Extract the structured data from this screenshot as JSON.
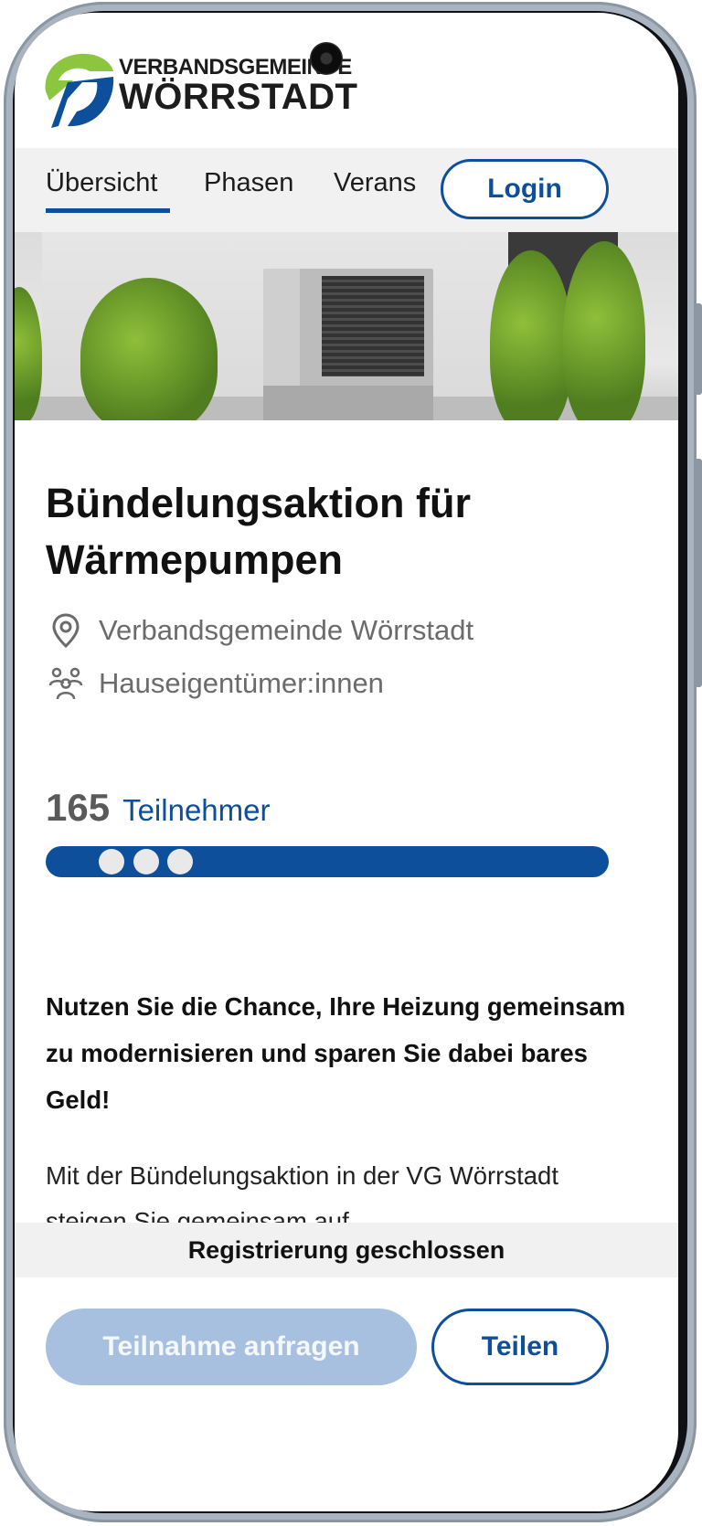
{
  "header": {
    "logo_top": "VERBANDSGEMEINDE",
    "logo_main": "WÖRRSTADT",
    "logo_colors": {
      "green": "#8cc63f",
      "blue": "#0e4f9c"
    }
  },
  "nav": {
    "tabs": [
      {
        "label": "Übersicht",
        "active": true
      },
      {
        "label": "Phasen",
        "active": false
      },
      {
        "label": "Verans",
        "active": false
      }
    ],
    "login_label": "Login"
  },
  "hero": {
    "icon": "heat-pump-photo"
  },
  "project": {
    "title": "Bündelungsaktion für Wärmepumpen",
    "location": "Verbandsgemeinde Wörrstadt",
    "audience": "Hauseigentümer:innen",
    "participants_count": "165",
    "participants_label": "Teilnehmer",
    "intro": "Nutzen Sie die Chance, Ihre Heizung gemeinsam zu modernisieren und sparen Sie dabei bares Geld!",
    "body": "Mit der Bündelungsaktion in der VG Wörrstadt steigen Sie gemeinsam auf"
  },
  "status": {
    "registration": "Registrierung geschlossen"
  },
  "actions": {
    "request_label": "Teilnahme anfragen",
    "share_label": "Teilen"
  },
  "colors": {
    "accent": "#0e4f9c",
    "disabled": "#a7c0df",
    "muted_text": "#6b6b6b"
  }
}
